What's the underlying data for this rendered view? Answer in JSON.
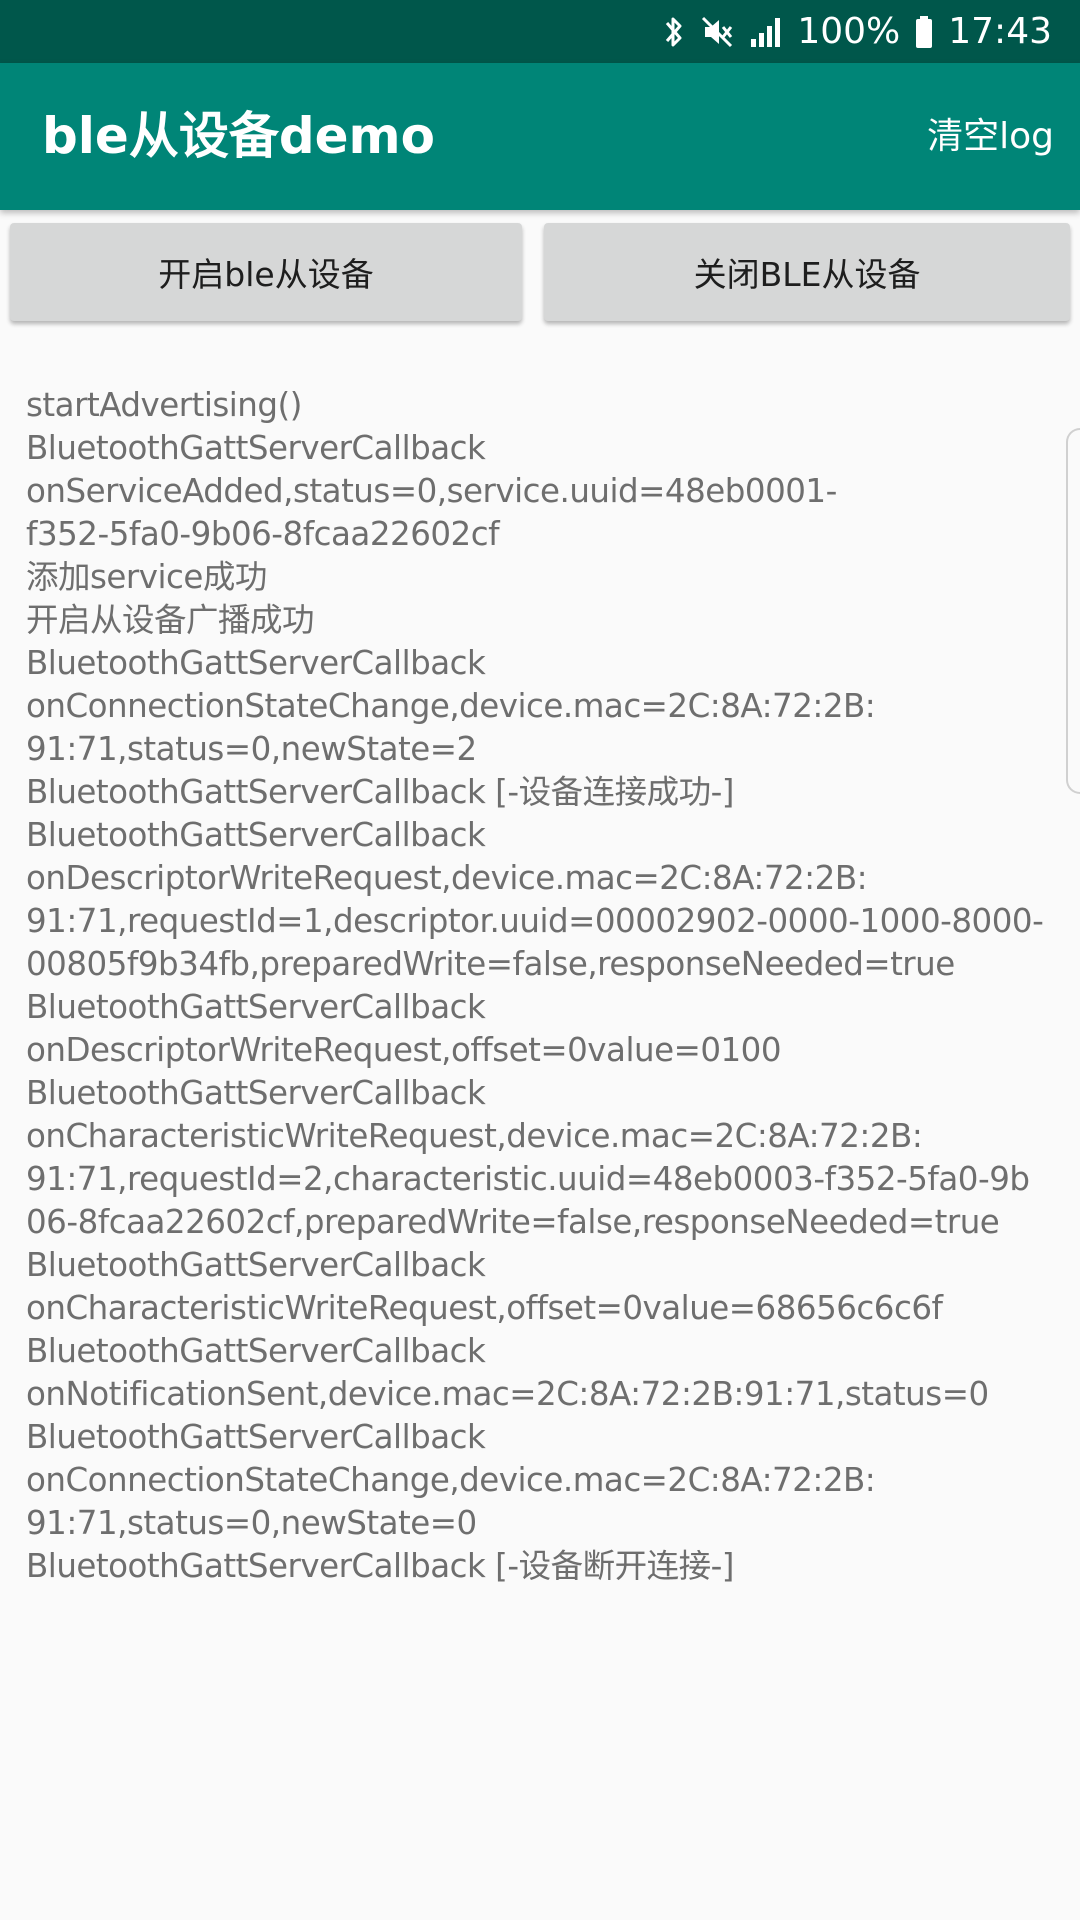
{
  "status_bar": {
    "battery": "100%",
    "time": "17:43",
    "icons": [
      "bluetooth-icon",
      "mute-icon",
      "signal-icon",
      "battery-icon"
    ]
  },
  "app_bar": {
    "title": "ble从设备demo",
    "action": "清空log"
  },
  "buttons": {
    "start": "开启ble从设备",
    "stop": "关闭BLE从设备"
  },
  "log": [
    "startAdvertising()",
    "BluetoothGattServerCallback",
    "onServiceAdded,status=0,service.uuid=48eb0001-",
    "f352-5fa0-9b06-8fcaa22602cf",
    "添加service成功",
    "开启从设备广播成功",
    "BluetoothGattServerCallback",
    "onConnectionStateChange,device.mac=2C:8A:72:2B:",
    "91:71,status=0,newState=2",
    "BluetoothGattServerCallback [-设备连接成功-]",
    "BluetoothGattServerCallback",
    "onDescriptorWriteRequest,device.mac=2C:8A:72:2B:",
    "91:71,requestId=1,descriptor.uuid=00002902-0000-1000-8000-",
    "00805f9b34fb,preparedWrite=false,responseNeeded=true",
    "BluetoothGattServerCallback",
    "onDescriptorWriteRequest,offset=0value=0100",
    "BluetoothGattServerCallback",
    "onCharacteristicWriteRequest,device.mac=2C:8A:72:2B:",
    "91:71,requestId=2,characteristic.uuid=48eb0003-f352-5fa0-9b",
    "06-8fcaa22602cf,preparedWrite=false,responseNeeded=true",
    "BluetoothGattServerCallback",
    "onCharacteristicWriteRequest,offset=0value=68656c6c6f",
    "BluetoothGattServerCallback",
    "onNotificationSent,device.mac=2C:8A:72:2B:91:71,status=0",
    "BluetoothGattServerCallback",
    "onConnectionStateChange,device.mac=2C:8A:72:2B:",
    "91:71,status=0,newState=0",
    "BluetoothGattServerCallback [-设备断开连接-]"
  ],
  "colors": {
    "status_bar": "#00574b",
    "app_bar": "#008577",
    "button": "#d6d7d7",
    "background": "#fafafa",
    "log_text": "#6e6e6e"
  }
}
